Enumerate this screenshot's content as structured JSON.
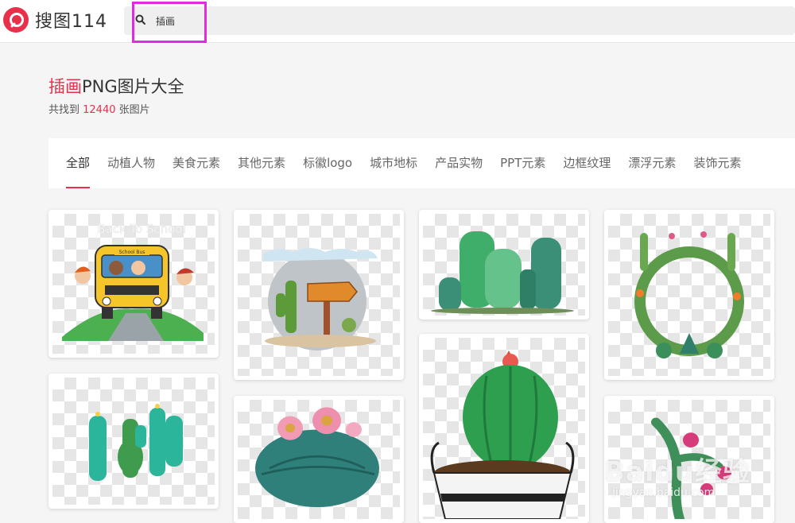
{
  "header": {
    "logo_text": "搜图114",
    "search_value": "插画"
  },
  "page": {
    "title_keyword": "插画",
    "title_rest": "PNG图片大全",
    "count_prefix": "共找到 ",
    "count_value": "12440",
    "count_suffix": " 张图片"
  },
  "tabs": [
    "全部",
    "动植人物",
    "美食元素",
    "其他元素",
    "标徽logo",
    "城市地标",
    "产品实物",
    "PPT元素",
    "边框纹理",
    "漂浮元素",
    "装饰元素"
  ],
  "cards": {
    "bus_caption": "Back To School",
    "bus_sign": "School Bus"
  },
  "watermark": {
    "main": "Baidu经验",
    "sub": "jingyan.baidu.com"
  },
  "colors": {
    "accent": "#e8304a",
    "highlight_box": "#e22ae0"
  }
}
